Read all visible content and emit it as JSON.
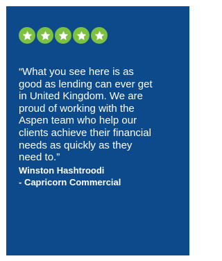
{
  "rating": {
    "stars": 5,
    "max": 5,
    "star_color": "#7cc142",
    "star_icon": "star-icon"
  },
  "quote": {
    "lines": [
      "“What you see here is as",
      "good as lending can ever get",
      "in United Kingdom. We are",
      "proud of working with the",
      "Aspen team who help our",
      "clients achieve their financial",
      "needs as quickly as they",
      "need to.”"
    ]
  },
  "author": {
    "name": "Winston Hashtroodi",
    "company": "- Capricorn Commercial"
  },
  "colors": {
    "card_background": "#0d4a8b",
    "text": "#ffffff"
  }
}
